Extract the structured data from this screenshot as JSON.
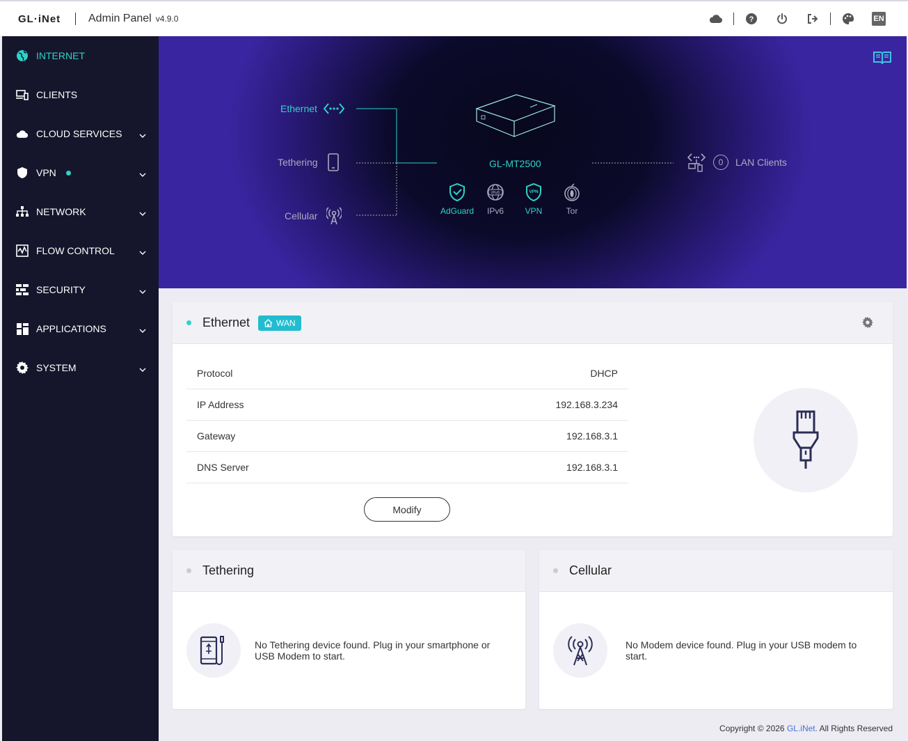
{
  "header": {
    "logo": "GL·iNet",
    "title": "Admin Panel",
    "version": "v4.9.0",
    "lang": "EN"
  },
  "sidebar": {
    "items": [
      {
        "label": "INTERNET",
        "icon": "globe-icon"
      },
      {
        "label": "CLIENTS",
        "icon": "devices-icon"
      },
      {
        "label": "CLOUD SERVICES",
        "icon": "cloud-icon"
      },
      {
        "label": "VPN",
        "icon": "shield-icon"
      },
      {
        "label": "NETWORK",
        "icon": "network-icon"
      },
      {
        "label": "FLOW CONTROL",
        "icon": "flow-icon"
      },
      {
        "label": "SECURITY",
        "icon": "firewall-icon"
      },
      {
        "label": "APPLICATIONS",
        "icon": "grid-icon"
      },
      {
        "label": "SYSTEM",
        "icon": "gear-icon"
      }
    ]
  },
  "topology": {
    "ethernet": "Ethernet",
    "tethering": "Tethering",
    "cellular": "Cellular",
    "device": "GL-MT2500",
    "lan_count": "0",
    "lan_label": "LAN Clients",
    "services": [
      {
        "label": "AdGuard",
        "on": true
      },
      {
        "label": "IPv6",
        "on": false
      },
      {
        "label": "VPN",
        "on": true
      },
      {
        "label": "Tor",
        "on": false
      }
    ]
  },
  "ethernet_card": {
    "title": "Ethernet",
    "badge": "WAN",
    "rows": [
      {
        "label": "Protocol",
        "value": "DHCP"
      },
      {
        "label": "IP Address",
        "value": "192.168.3.234"
      },
      {
        "label": "Gateway",
        "value": "192.168.3.1"
      },
      {
        "label": "DNS Server",
        "value": "192.168.3.1"
      }
    ],
    "modify": "Modify"
  },
  "tethering_card": {
    "title": "Tethering",
    "message": "No Tethering device found. Plug in your smartphone or USB Modem to start."
  },
  "cellular_card": {
    "title": "Cellular",
    "message": "No Modem device found. Plug in your USB modem to start."
  },
  "footer": {
    "prefix": "Copyright © 2026",
    "brand": "GL.iNet.",
    "suffix": "All Rights Reserved"
  },
  "colors": {
    "accent": "#2ed3c6",
    "sidebar": "#15152b",
    "badge": "#22bcd0"
  }
}
